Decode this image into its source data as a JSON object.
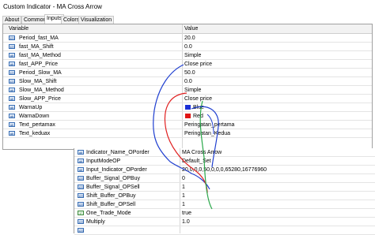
{
  "window": {
    "title": "Custom Indicator - MA Cross Arrow"
  },
  "tabs": [
    "About",
    "Common",
    "Inputs",
    "Colors",
    "Visualization"
  ],
  "active_tab": "Inputs",
  "table": {
    "headers": [
      "Variable",
      "Value"
    ],
    "rows": [
      {
        "name": "Period_fast_MA",
        "value": "20.0",
        "icon": "123"
      },
      {
        "name": "fast_MA_Shift",
        "value": "0.0",
        "icon": "123"
      },
      {
        "name": "fast_MA_Method",
        "value": "Simple",
        "icon": "ab"
      },
      {
        "name": "fast_APP_Price",
        "value": "Close price",
        "icon": "ab"
      },
      {
        "name": "Period_Slow_MA",
        "value": "50.0",
        "icon": "123"
      },
      {
        "name": "Slow_MA_Shift",
        "value": "0.0",
        "icon": "123"
      },
      {
        "name": "Slow_MA_Method",
        "value": "Simple",
        "icon": "ab"
      },
      {
        "name": "Slow_APP_Price",
        "value": "Close price",
        "icon": "ab"
      },
      {
        "name": "WarnaUp",
        "value": "Blue",
        "icon": "ab",
        "swatch": "#1a2fd6"
      },
      {
        "name": "WarnaDown",
        "value": "Red",
        "icon": "ab",
        "swatch": "#e01515"
      },
      {
        "name": "Text_pertamax",
        "value": "Peringatan_pertama",
        "icon": "ab"
      },
      {
        "name": "Text_keduax",
        "value": "Peringatan_Kedua",
        "icon": "ab"
      }
    ]
  },
  "table2": {
    "rows": [
      {
        "name": "Indicator_Name_OPorder",
        "value": "MA Cross Arrow",
        "icon": "ab"
      },
      {
        "name": "InputModeOP",
        "value": "Default_Set",
        "icon": "ab"
      },
      {
        "name": "Input_Indicator_OPorder",
        "value": "20,0,0,0,50,0,0,0,65280,16776960",
        "icon": "ab"
      },
      {
        "name": "Buffer_Signal_OPBuy",
        "value": "0",
        "icon": "123"
      },
      {
        "name": "Buffer_Signal_OPSell",
        "value": "1",
        "icon": "123"
      },
      {
        "name": "Shift_Buffer_OPBuy",
        "value": "1",
        "icon": "123"
      },
      {
        "name": "Shift_Buffer_OPSell",
        "value": "1",
        "icon": "123"
      },
      {
        "name": "One_Trade_Mode",
        "value": "true",
        "icon": "tog"
      },
      {
        "name": "Multiply",
        "value": "1.0",
        "icon": "123"
      },
      {
        "name": "",
        "value": "",
        "icon": "123"
      }
    ]
  },
  "colors": {
    "blue_ink": "#1f3fd0",
    "red_ink": "#e02020",
    "green_ink": "#2aa84a",
    "grid": "#e4e4e4"
  }
}
